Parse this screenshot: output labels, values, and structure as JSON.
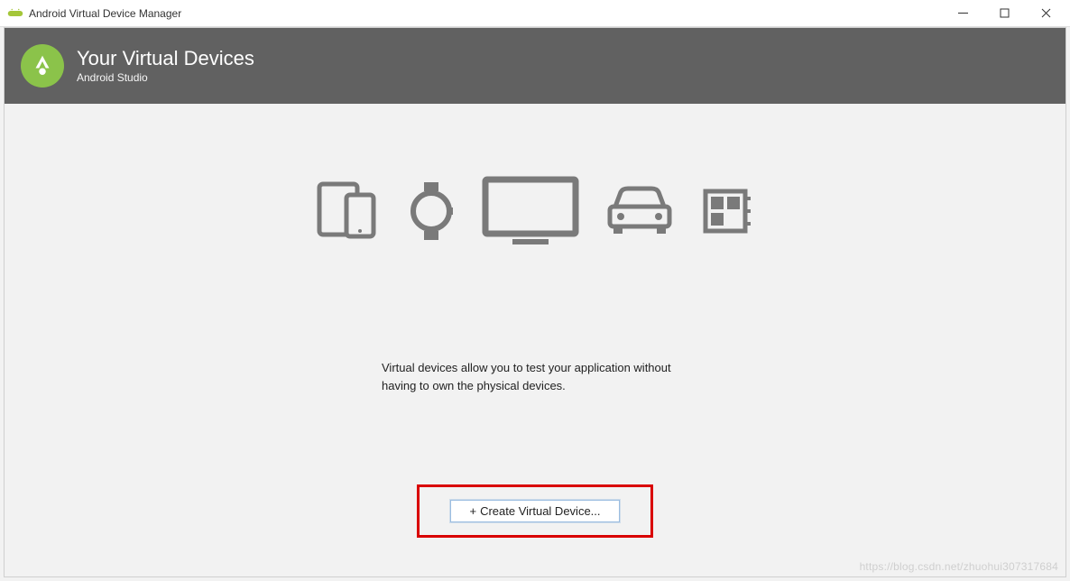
{
  "window": {
    "title": "Android Virtual Device Manager"
  },
  "header": {
    "title": "Your Virtual Devices",
    "subtitle": "Android Studio"
  },
  "main": {
    "info_text": "Virtual devices allow you to test your application without having to own the physical devices.",
    "create_button_label": "Create Virtual Device..."
  },
  "watermark": "https://blog.csdn.net/zhuohui307317684",
  "icons": {
    "phone_tablet": "phone-tablet-icon",
    "wear": "wear-icon",
    "tv": "tv-icon",
    "automotive": "automotive-icon",
    "things": "things-icon"
  }
}
